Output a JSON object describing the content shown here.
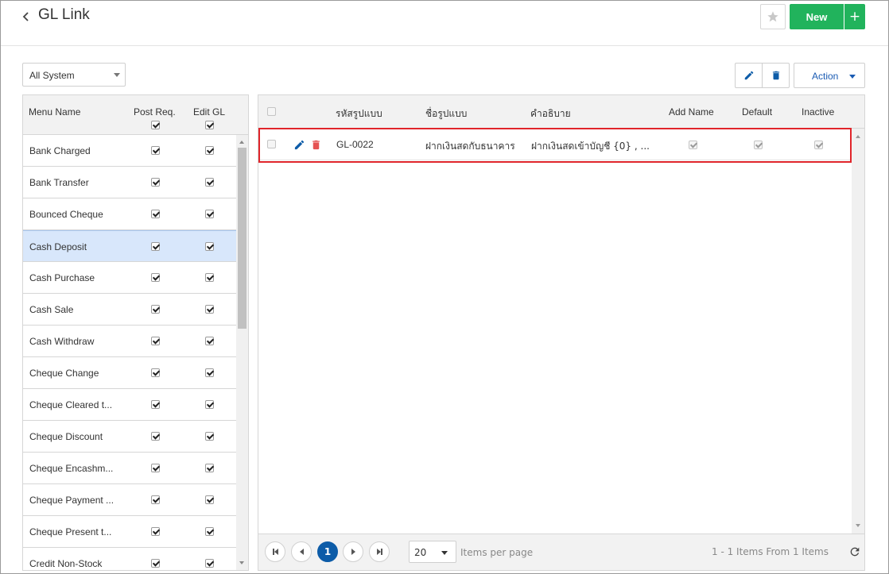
{
  "header": {
    "title": "GL Link",
    "new_label": "New",
    "plus_label": "+"
  },
  "filter": {
    "system_value": "All System"
  },
  "menu": {
    "col_name": "Menu Name",
    "col_post": "Post Req.",
    "col_edit": "Edit GL",
    "items": [
      {
        "label": "Bank Charged",
        "post": true,
        "edit": true
      },
      {
        "label": "Bank Transfer",
        "post": true,
        "edit": true
      },
      {
        "label": "Bounced Cheque",
        "post": true,
        "edit": true
      },
      {
        "label": "Cash Deposit",
        "post": true,
        "edit": true,
        "selected": true
      },
      {
        "label": "Cash Purchase",
        "post": true,
        "edit": true
      },
      {
        "label": "Cash Sale",
        "post": true,
        "edit": true
      },
      {
        "label": "Cash Withdraw",
        "post": true,
        "edit": true
      },
      {
        "label": "Cheque Change",
        "post": true,
        "edit": true
      },
      {
        "label": "Cheque Cleared t...",
        "post": true,
        "edit": true
      },
      {
        "label": "Cheque Discount",
        "post": true,
        "edit": true
      },
      {
        "label": "Cheque Encashm...",
        "post": true,
        "edit": true
      },
      {
        "label": "Cheque Payment ...",
        "post": true,
        "edit": true
      },
      {
        "label": "Cheque Present t...",
        "post": true,
        "edit": true
      },
      {
        "label": "Credit Non-Stock",
        "post": true,
        "edit": true
      }
    ]
  },
  "toolbar": {
    "action_label": "Action"
  },
  "grid": {
    "columns": {
      "code": "รหัสรูปแบบ",
      "name": "ชื่อรูปแบบ",
      "desc": "คำอธิบาย",
      "add_name": "Add Name",
      "default": "Default",
      "inactive": "Inactive"
    },
    "rows": [
      {
        "code": "GL-0022",
        "name": "ฝากเงินสดกับธนาคาร",
        "desc": "ฝากเงินสดเข้าบัญชี {0} , ...",
        "add_name": true,
        "default": true,
        "inactive": true
      }
    ]
  },
  "pager": {
    "current_page": "1",
    "page_size": "20",
    "items_per_page_label": "Items per page",
    "summary": "1 - 1 Items From 1 Items"
  },
  "colors": {
    "accent_green": "#21b35c",
    "accent_blue": "#0d5ca8",
    "delete_red": "#e55353",
    "highlight_red": "#e0252b",
    "selected_row": "#d8e7fb"
  }
}
